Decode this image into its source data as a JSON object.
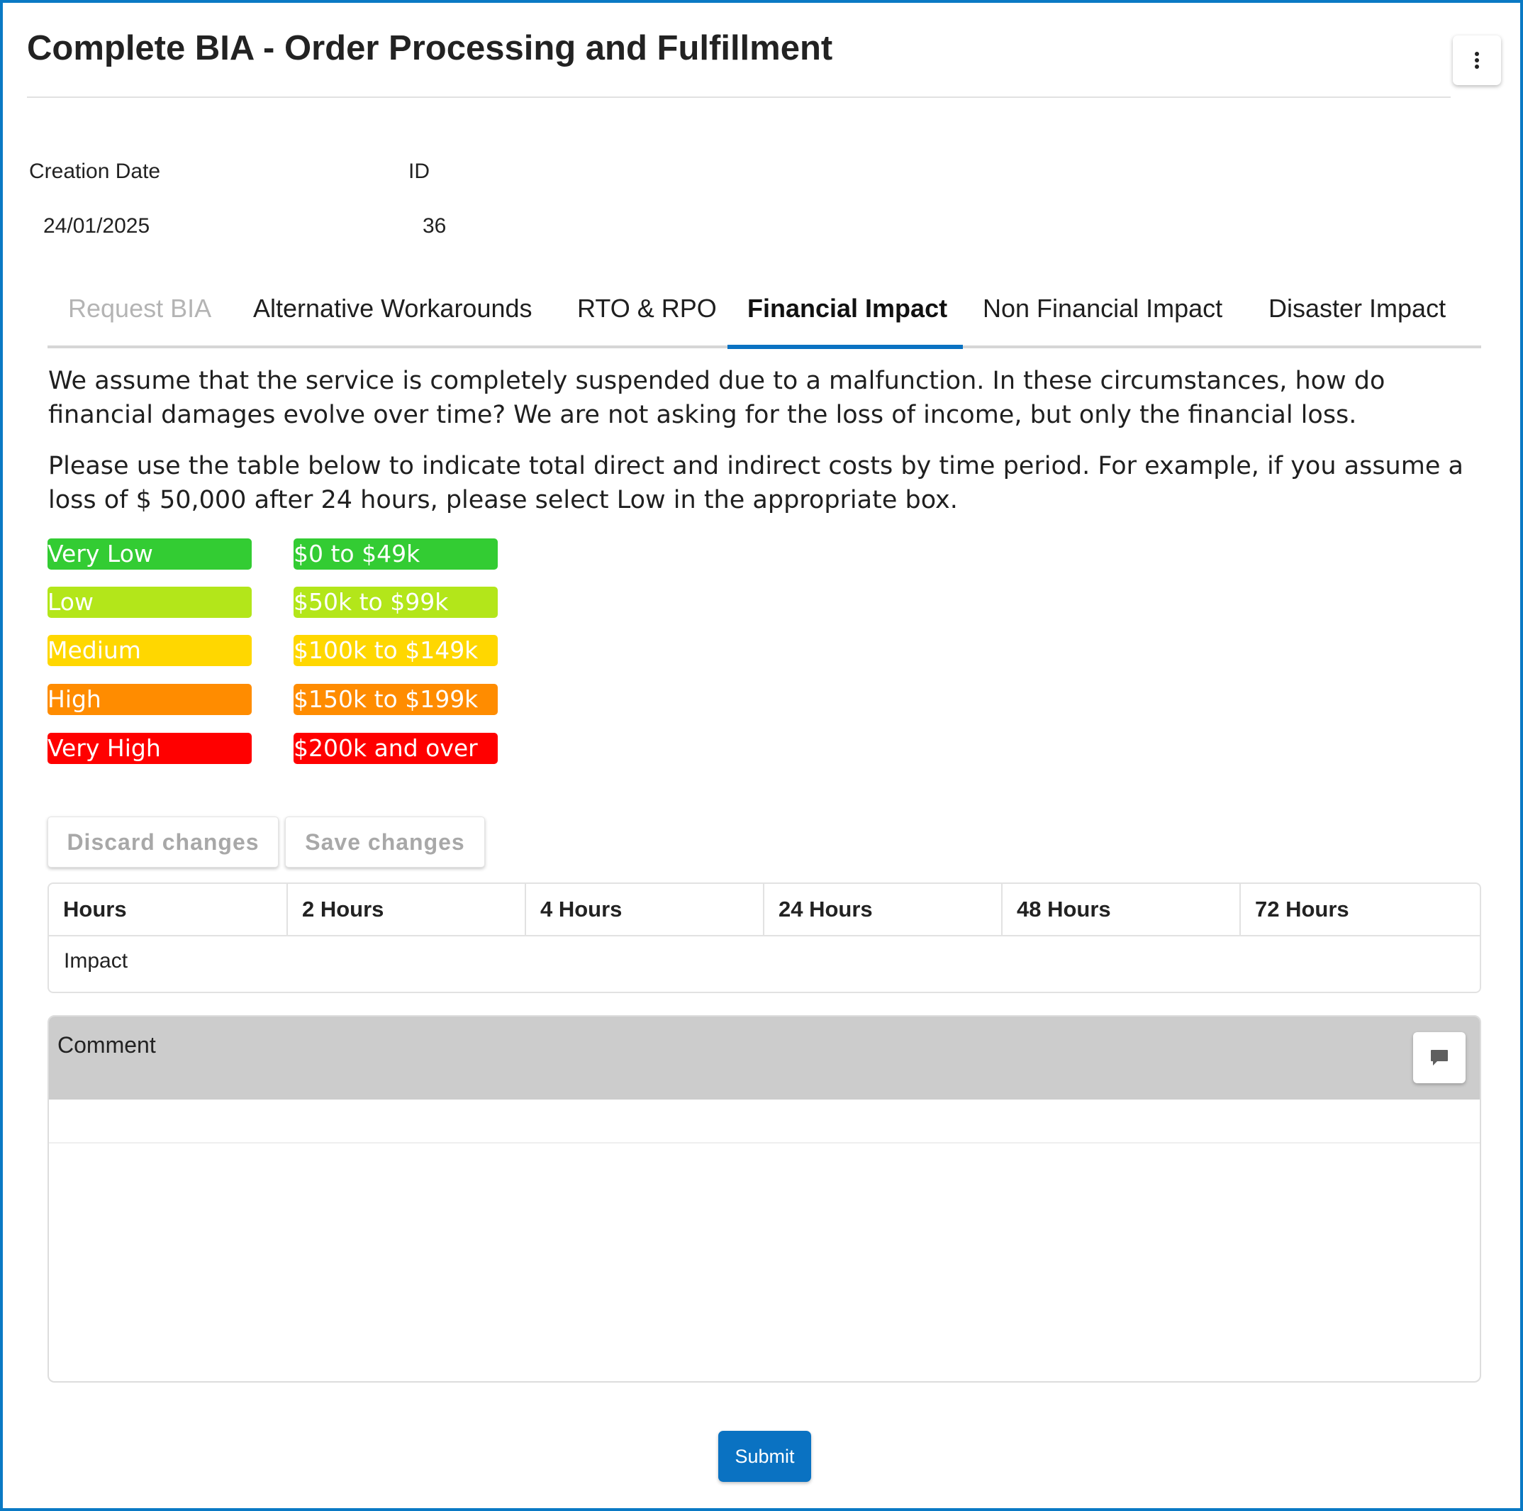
{
  "page": {
    "title": "Complete BIA - Order Processing and Fulfillment",
    "menu_icon": "more-vertical-icon"
  },
  "fields": {
    "creation_date_label": "Creation Date",
    "creation_date_value": "24/01/2025",
    "id_label": "ID",
    "id_value": "36"
  },
  "tabs": [
    {
      "label": "Request BIA",
      "state": "disabled"
    },
    {
      "label": "Alternative Workarounds",
      "state": "normal"
    },
    {
      "label": "RTO & RPO",
      "state": "normal"
    },
    {
      "label": "Financial Impact",
      "state": "active"
    },
    {
      "label": "Non Financial Impact",
      "state": "normal"
    },
    {
      "label": "Disaster Impact",
      "state": "normal"
    }
  ],
  "intro": {
    "para1": "We assume that the service is completely suspended due to a malfunction. In these circumstances, how do financial damages evolve over time? We are not asking for the loss of income, but only the financial loss.",
    "para2": "Please use the table below to indicate total direct and indirect costs by time period. For example, if you assume a loss of $ 50,000 after 24 hours, please select Low in the appropriate box."
  },
  "legend": [
    {
      "level": "Very Low",
      "range": "$0 to $49k",
      "color": "#33cc33"
    },
    {
      "level": "Low",
      "range": "$50k to $99k",
      "color": "#b3e61a"
    },
    {
      "level": "Medium",
      "range": "$100k to $149k",
      "color": "#ffd700"
    },
    {
      "level": "High",
      "range": "$150k to $199k",
      "color": "#ff8c00"
    },
    {
      "level": "Very High",
      "range": "$200k and over",
      "color": "#ff0000"
    }
  ],
  "actions": {
    "discard_label": "Discard changes",
    "save_label": "Save changes"
  },
  "table": {
    "headers": [
      "Hours",
      "2 Hours",
      "4 Hours",
      "24 Hours",
      "48 Hours",
      "72 Hours"
    ],
    "rows": [
      {
        "label": "Impact"
      }
    ]
  },
  "comment": {
    "title": "Comment",
    "icon": "comment-icon",
    "value": ""
  },
  "submit_label": "Submit",
  "colors": {
    "accent": "#0a72c2",
    "frame": "#0a79c4"
  }
}
